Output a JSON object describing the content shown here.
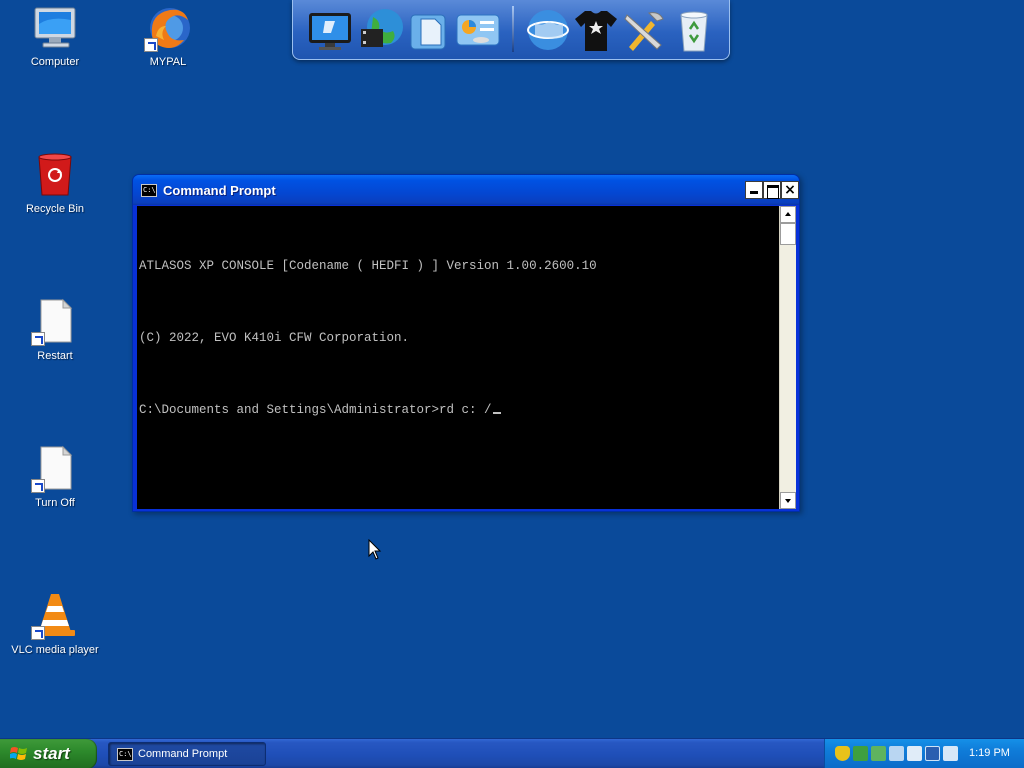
{
  "desktop": {
    "icons": [
      {
        "label": "Computer",
        "icon": "computer-icon"
      },
      {
        "label": "MYPAL",
        "icon": "mypal-browser-icon"
      },
      {
        "label": "Recycle Bin",
        "icon": "recycle-bin-icon"
      },
      {
        "label": "Restart",
        "icon": "document-shortcut-icon"
      },
      {
        "label": "Turn Off",
        "icon": "document-shortcut-icon"
      },
      {
        "label": "VLC media player",
        "icon": "vlc-cone-icon"
      }
    ]
  },
  "dock": {
    "items": [
      "monitor-icon",
      "globe-film-icon",
      "documents-icon",
      "control-panel-icon",
      "internet-globe-icon",
      "t-shirt-icon",
      "tools-icon",
      "recycle-bin-icon"
    ]
  },
  "window": {
    "title": "Command Prompt",
    "close_glyph": "×",
    "icon_text": "C:\\",
    "console_lines": [
      "ATLASOS XP CONSOLE [Codename ( HEDFI ) ] Version 1.00.2600.10",
      "(C) 2022, EVO K410i CFW Corporation.",
      "C:\\Documents and Settings\\Administrator>rd c: /"
    ]
  },
  "taskbar": {
    "start_label": "start",
    "task_label": "Command Prompt",
    "clock": "1:19 PM",
    "colors": {
      "start_green": "#2d8a2c",
      "taskbar_blue": "#1f4fb8",
      "tray_blue": "#0f7bd8"
    }
  }
}
